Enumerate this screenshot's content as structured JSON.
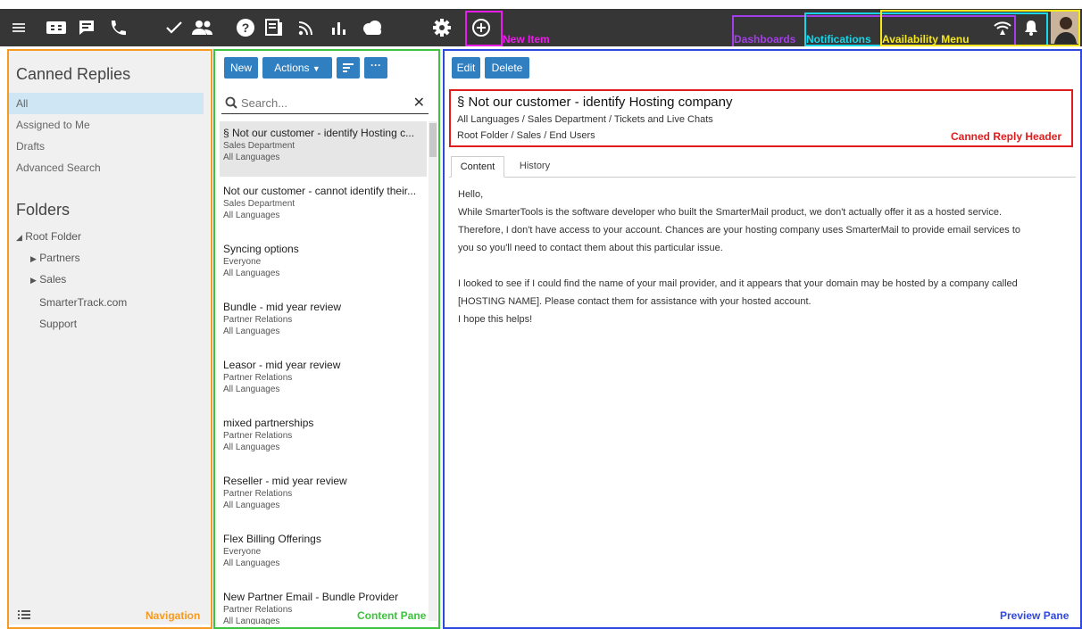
{
  "annotations": {
    "new_item": "New Item",
    "dashboards": "Dashboards",
    "notifications": "Notifications",
    "availability": "Availability Menu",
    "navigation": "Navigation",
    "content_pane": "Content Pane",
    "canned_reply_header": "Canned Reply Header",
    "preview_pane": "Preview Pane"
  },
  "topbar_icons": [
    "menu-icon",
    "ticket-icon",
    "chat-icon",
    "phone-icon",
    "check-icon",
    "people-icon",
    "help-icon",
    "canned-replies-icon",
    "rss-icon",
    "chart-icon",
    "cloud-icon",
    "gear-icon",
    "add-circle-icon"
  ],
  "nav": {
    "title": "Canned Replies",
    "items": [
      "All",
      "Assigned to Me",
      "Drafts",
      "Advanced Search"
    ],
    "folders_title": "Folders",
    "root": "Root Folder",
    "partners": "Partners",
    "sales": "Sales",
    "smartertrack": "SmarterTrack.com",
    "support": "Support"
  },
  "list": {
    "new_label": "New",
    "actions_label": "Actions",
    "search_placeholder": "Search...",
    "items": [
      {
        "title": "§ Not our customer - identify Hosting c...",
        "dept": "Sales Department",
        "lang": "All Languages"
      },
      {
        "title": "Not our customer - cannot identify their...",
        "dept": "Sales Department",
        "lang": "All Languages"
      },
      {
        "title": "Syncing options",
        "dept": "Everyone",
        "lang": "All Languages"
      },
      {
        "title": "Bundle - mid year review",
        "dept": "Partner Relations",
        "lang": "All Languages"
      },
      {
        "title": "Leasor - mid year review",
        "dept": "Partner Relations",
        "lang": "All Languages"
      },
      {
        "title": "mixed partnerships",
        "dept": "Partner Relations",
        "lang": "All Languages"
      },
      {
        "title": "Reseller - mid year review",
        "dept": "Partner Relations",
        "lang": "All Languages"
      },
      {
        "title": "Flex Billing Offerings",
        "dept": "Everyone",
        "lang": "All Languages"
      },
      {
        "title": "New Partner Email - Bundle Provider",
        "dept": "Partner Relations",
        "lang": "All Languages"
      }
    ]
  },
  "preview": {
    "edit_label": "Edit",
    "delete_label": "Delete",
    "title": "§ Not our customer - identify Hosting company",
    "line1": "All Languages / Sales Department / Tickets and Live Chats",
    "line2": "Root Folder / Sales / End Users",
    "tab_content": "Content",
    "tab_history": "History",
    "body": [
      "Hello,",
      "While SmarterTools is the software developer who built the SmarterMail product, we don't actually offer it as a hosted service.",
      "Therefore, I don't have access to your account. Chances are your hosting company uses SmarterMail to provide email services to",
      "you so you'll need to contact them about this particular issue.",
      "",
      "I looked to see if I could find the name of your mail provider, and it appears that your domain may be hosted by a company called",
      "[HOSTING NAME]. Please contact them for assistance with your hosted account.",
      "I hope this helps!"
    ]
  },
  "colors": {
    "topbar": "#363636",
    "accent": "#2f7fc1",
    "new_item": "#e81ee8",
    "dashboards": "#a43ee8",
    "notifications": "#18d6e8",
    "availability": "#f5e71c",
    "navigation": "#f59a23",
    "content_pane": "#3cc43c",
    "canned_reply_header": "#e01c1c",
    "preview_pane": "#2f48e0"
  }
}
